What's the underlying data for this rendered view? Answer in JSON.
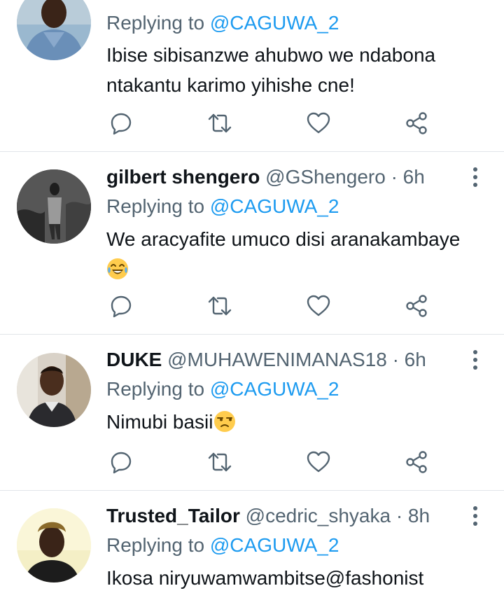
{
  "tweets": [
    {
      "name": "",
      "handle": "",
      "time": "",
      "replying_prefix": "Replying to ",
      "replying_handle": "@CAGUWA_2",
      "text": "Ibise sibisanzwe ahubwo we ndabona ntakantu karimo yihishe cne!",
      "emoji": ""
    },
    {
      "name": "gilbert shengero",
      "handle": "@GShengero",
      "time": "· 6h",
      "replying_prefix": "Replying to ",
      "replying_handle": "@CAGUWA_2",
      "text": "We aracyafite umuco disi aranakambaye",
      "emoji": "face-with-tears-of-joy"
    },
    {
      "name": "DUKE",
      "handle": "@MUHAWENIMANAS18",
      "time": "· 6h",
      "replying_prefix": "Replying to ",
      "replying_handle": "@CAGUWA_2",
      "text": "Nimubi basii",
      "emoji": "unamused-face"
    },
    {
      "name": "Trusted_Tailor",
      "handle": "@cedric_shyaka",
      "time": "· 8h",
      "replying_prefix": "Replying to ",
      "replying_handle": "@CAGUWA_2",
      "text": "Ikosa niryuwamwambitse@fashonist",
      "emoji": ""
    }
  ],
  "icons": {
    "reply": "reply-icon",
    "retweet": "retweet-icon",
    "like": "heart-icon",
    "share": "share-icon",
    "more": "more-icon"
  },
  "colors": {
    "link": "#1d9bf0",
    "secondary": "#536471",
    "primary_text": "#0f1419",
    "divider": "#e1e5e9"
  }
}
